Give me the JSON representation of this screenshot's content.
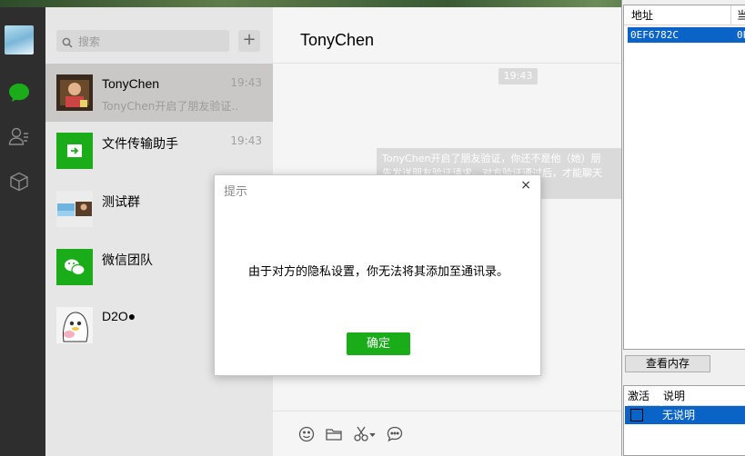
{
  "search": {
    "placeholder": "搜索"
  },
  "chats": [
    {
      "name": "TonyChen",
      "time": "19:43",
      "preview": "TonyChen开启了朋友验证..."
    },
    {
      "name": "文件传输助手",
      "time": "19:43",
      "preview": ""
    },
    {
      "name": "测试群",
      "time": "",
      "preview": ""
    },
    {
      "name": "微信团队",
      "time": "",
      "preview": ""
    },
    {
      "name": "D2O●",
      "time": "",
      "preview": ""
    }
  ],
  "conversation": {
    "title": "TonyChen",
    "time_label": "19:43",
    "system_message_line1": "TonyChen开启了朋友验证，你还不是他（她）朋",
    "system_message_line2": "先发送朋友验证请求，对方验证通过后，才能聊天"
  },
  "dialog": {
    "title": "提示",
    "message": "由于对方的隐私设置，你无法将其添加至通讯录。",
    "ok_label": "确定",
    "close_glyph": "×"
  },
  "side_window": {
    "col_address": "地址",
    "col_current": "当",
    "address_value": "0EF6782C",
    "current_value": "0E",
    "view_memory_label": "查看内存",
    "col_active": "激活",
    "col_description": "说明",
    "row_description": "无说明"
  },
  "colors": {
    "wechat_green": "#1aad19",
    "selection_blue": "#0a64c8",
    "sidebar_dark": "#2e2e2e"
  }
}
